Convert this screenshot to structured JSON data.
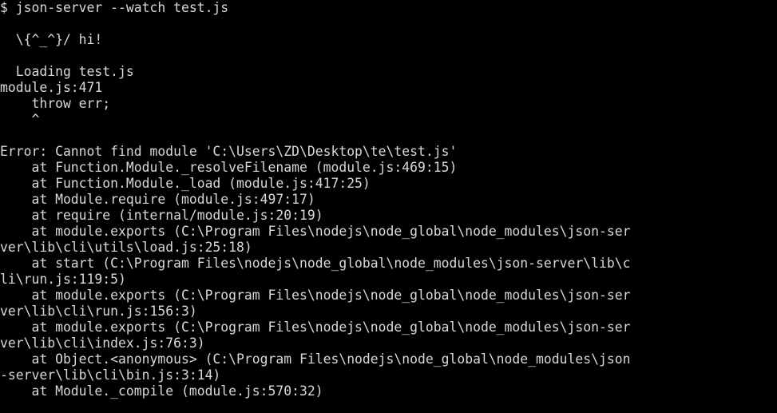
{
  "terminal": {
    "lines": [
      "$ json-server --watch test.js",
      "",
      "  \\{^_^}/ hi!",
      "",
      "  Loading test.js",
      "module.js:471",
      "    throw err;",
      "    ^",
      "",
      "Error: Cannot find module 'C:\\Users\\ZD\\Desktop\\te\\test.js'",
      "    at Function.Module._resolveFilename (module.js:469:15)",
      "    at Function.Module._load (module.js:417:25)",
      "    at Module.require (module.js:497:17)",
      "    at require (internal/module.js:20:19)",
      "    at module.exports (C:\\Program Files\\nodejs\\node_global\\node_modules\\json-ser",
      "ver\\lib\\cli\\utils\\load.js:25:18)",
      "    at start (C:\\Program Files\\nodejs\\node_global\\node_modules\\json-server\\lib\\c",
      "li\\run.js:119:5)",
      "    at module.exports (C:\\Program Files\\nodejs\\node_global\\node_modules\\json-ser",
      "ver\\lib\\cli\\run.js:156:3)",
      "    at module.exports (C:\\Program Files\\nodejs\\node_global\\node_modules\\json-ser",
      "ver\\lib\\cli\\index.js:76:3)",
      "    at Object.<anonymous> (C:\\Program Files\\nodejs\\node_global\\node_modules\\json",
      "-server\\lib\\cli\\bin.js:3:14)",
      "    at Module._compile (module.js:570:32)"
    ]
  }
}
